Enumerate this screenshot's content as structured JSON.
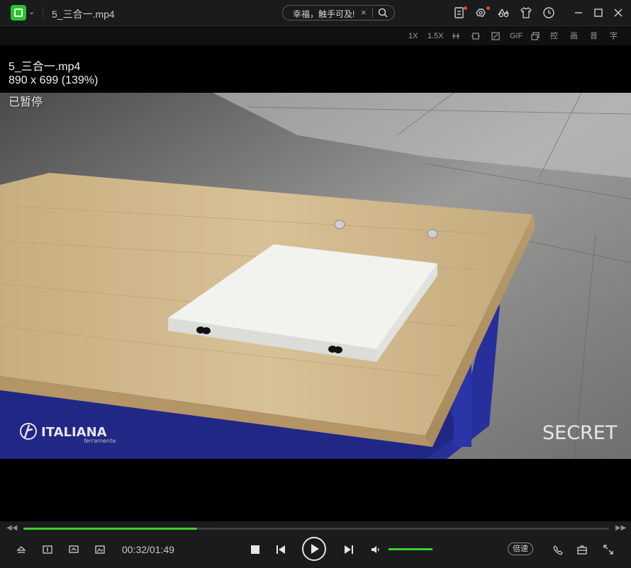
{
  "window": {
    "file_title": "5_三合一.mp4",
    "search_placeholder": "幸福，触手可及!",
    "accent_color": "#25c72a"
  },
  "toolbar": {
    "speed_1x": "1X",
    "speed_15x": "1.5X",
    "gif": "GIF",
    "control": "控",
    "picture": "画",
    "audio": "音",
    "subtitle": "字"
  },
  "osd": {
    "filename": "5_三合一.mp4",
    "resolution": "890 x 699 (139%)",
    "status": "已暂停"
  },
  "video": {
    "brand_left": "ITALIANA",
    "brand_left_sub": "ferramenta",
    "brand_right": "SECRET"
  },
  "playback": {
    "time": "00:32/01:49",
    "progress_fraction": 0.297,
    "volume_fraction": 1.0,
    "speed_label": "倍速"
  }
}
